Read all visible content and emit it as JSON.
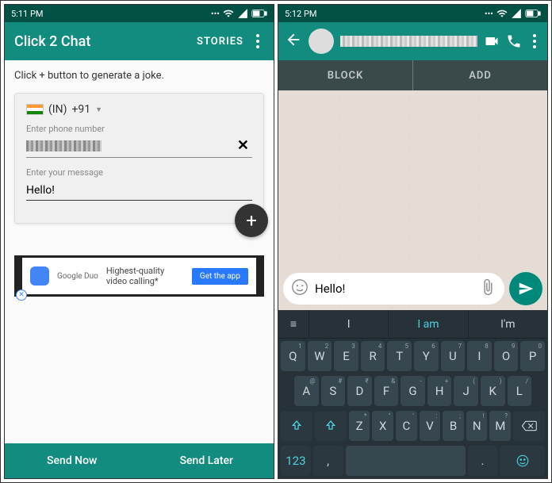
{
  "left": {
    "status_time": "5:11 PM",
    "app_title": "Click 2 Chat",
    "stories_label": "STORIES",
    "hint": "Click + button to generate a joke.",
    "country_code": "(IN)",
    "dial_code": "+91",
    "phone_label": "Enter phone number",
    "msg_label": "Enter your message",
    "msg_value": "Hello!",
    "ad": {
      "brand": "Google Duo",
      "text": "Highest-quality video calling*",
      "cta": "Get the app"
    },
    "send_now": "Send Now",
    "send_later": "Send Later"
  },
  "right": {
    "status_time": "5:12 PM",
    "block_label": "BLOCK",
    "add_label": "ADD",
    "compose_value": "Hello!",
    "suggestions": [
      "I",
      "I am",
      "I'm"
    ],
    "keyboard": {
      "row1": [
        [
          "Q",
          "1"
        ],
        [
          "W",
          "2"
        ],
        [
          "E",
          "3"
        ],
        [
          "R",
          "4"
        ],
        [
          "T",
          "5"
        ],
        [
          "Y",
          "6"
        ],
        [
          "U",
          "7"
        ],
        [
          "I",
          "8"
        ],
        [
          "O",
          "9"
        ],
        [
          "P",
          "0"
        ]
      ],
      "row2": [
        [
          "A",
          "@"
        ],
        [
          "S",
          "#"
        ],
        [
          "D",
          "₹"
        ],
        [
          "F",
          "&"
        ],
        [
          "G",
          "-"
        ],
        [
          "H",
          "+"
        ],
        [
          "J",
          "("
        ],
        [
          "K",
          ")"
        ],
        [
          "L",
          "/"
        ]
      ],
      "row3": [
        [
          "Z",
          "*"
        ],
        [
          "X",
          "\""
        ],
        [
          "C",
          "'"
        ],
        [
          "V",
          ":"
        ],
        [
          "B",
          ";"
        ],
        [
          "N",
          "!"
        ],
        [
          "M",
          "?"
        ]
      ],
      "num_key": "123",
      "comma": ",",
      "period": "."
    }
  }
}
